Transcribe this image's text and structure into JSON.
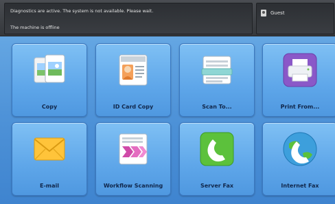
{
  "status": {
    "message": "Diagnostics are active. The system is not available. Please wait.",
    "machine": "The machine is offline"
  },
  "user": {
    "label": "Guest"
  },
  "apps": [
    {
      "label": "Copy",
      "icon": "copy-icon"
    },
    {
      "label": "ID Card Copy",
      "icon": "id-card-icon"
    },
    {
      "label": "Scan To...",
      "icon": "scanner-icon"
    },
    {
      "label": "Print From...",
      "icon": "printer-icon"
    },
    {
      "label": "E-mail",
      "icon": "envelope-icon"
    },
    {
      "label": "Workflow Scanning",
      "icon": "workflow-icon"
    },
    {
      "label": "Server Fax",
      "icon": "phone-icon"
    },
    {
      "label": "Internet Fax",
      "icon": "globe-phone-icon"
    }
  ],
  "colors": {
    "top_bar": "#3a3d42",
    "tile": "#5ea6e9",
    "background": "#4f93d8"
  }
}
